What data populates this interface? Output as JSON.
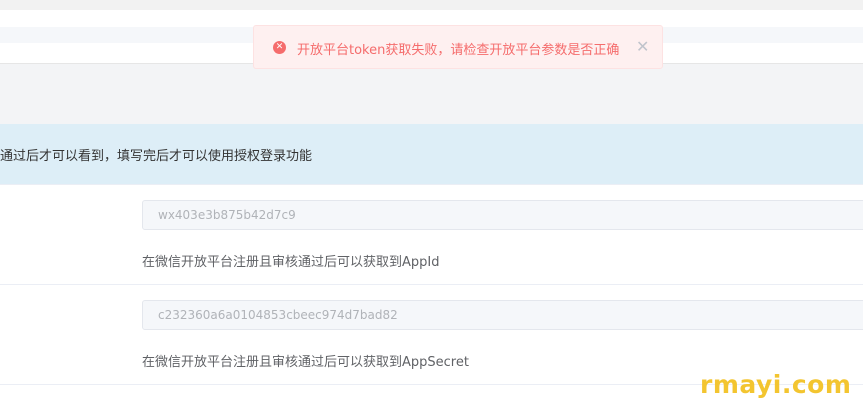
{
  "toast": {
    "message": "开放平台token获取失败，请检查开放平台参数是否正确",
    "error_icon": "error-circle-icon",
    "close_icon": "close-icon",
    "close_symbol": "✕",
    "colors": {
      "background": "#fef0f0",
      "text": "#f56c6c"
    }
  },
  "info_bar": {
    "text": "通过后才可以看到，填写完后才可以使用授权登录功能"
  },
  "fields": [
    {
      "value": "wx403e3b875b42d7c9",
      "hint": "在微信开放平台注册且审核通过后可以获取到AppId"
    },
    {
      "value": "c232360a6a0104853cbeec974d7bad82",
      "hint": "在微信开放平台注册且审核通过后可以获取到AppSecret"
    }
  ],
  "watermark": {
    "text": "rmayi.com",
    "color": "#f3c530"
  }
}
